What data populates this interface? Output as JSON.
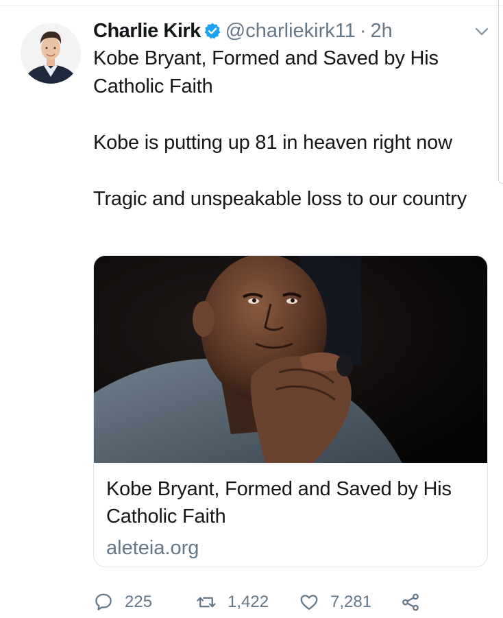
{
  "tweet": {
    "display_name": "Charlie Kirk",
    "handle": "@charliekirk11",
    "separator": "·",
    "time": "2h",
    "paragraphs": [
      "Kobe Bryant, Formed and Saved by His Catholic Faith",
      "Kobe is putting up 81 in heaven right now",
      "Tragic and unspeakable loss to our country"
    ]
  },
  "card": {
    "title": "Kobe Bryant, Formed and Saved by His Catholic Faith",
    "domain": "aleteia.org"
  },
  "actions": {
    "replies": "225",
    "retweets": "1,422",
    "likes": "7,281"
  },
  "icons": {
    "verified": "verified-badge-icon",
    "menu": "chevron-down-icon",
    "reply": "reply-icon",
    "retweet": "retweet-icon",
    "like": "heart-icon",
    "share": "share-icon"
  },
  "colors": {
    "text": "#14171a",
    "secondary": "#657786",
    "verified": "#1da1f2",
    "border": "#e1e8ed"
  }
}
